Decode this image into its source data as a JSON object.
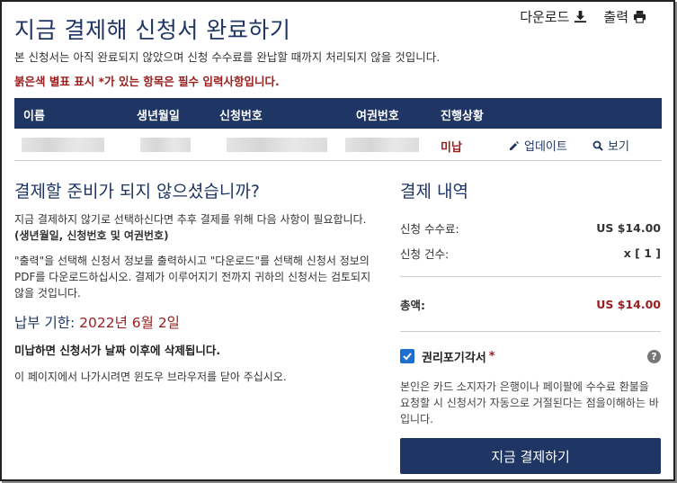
{
  "page": {
    "title": "지금 결제해 신청서 완료하기",
    "notice": "본 신청서는 아직 완료되지 않았으며 신청 수수료를 완납할 때까지 처리되지 않을 것입니다.",
    "required_note": "붉은색 별표 표시 *가 있는 항목은 필수 입력사항입니다."
  },
  "topbar": {
    "download_label": "다운로드",
    "print_label": "출력"
  },
  "table": {
    "headers": [
      "이름",
      "생년월일",
      "신청번호",
      "여권번호",
      "진행상황"
    ],
    "row": {
      "status": "미납",
      "update_label": "업데이트",
      "view_label": "보기"
    }
  },
  "left": {
    "heading": "결제할 준비가 되지 않으셨습니까?",
    "para1": "지금 결제하지 않기로 선택하신다면 추후 결제를 위해 다음 사항이 필요합니다.",
    "para1_bold": "(생년월일, 신청번호 및 여권번호)",
    "para2": "\"출력\"을 선택해 신청서 정보를 출력하시고 \"다운로드\"를 선택해 신청서 정보의 PDF를 다운로드하십시오. 결제가 이루어지기 전까지 귀하의 신청서는 검토되지 않을 것입니다.",
    "deadline_label": "납부 기한:",
    "deadline_date": "2022년 6월 2일",
    "warning": "미납하면 신청서가 날짜 이후에 삭제됩니다.",
    "close_note": "이 페이지에서 나가시려면 윈도우 브라우저를 닫아 주십시오."
  },
  "summary": {
    "heading": "결제 내역",
    "fee_label": "신청 수수료:",
    "fee_value": "US $14.00",
    "count_label": "신청 건수:",
    "count_value": "x [ 1 ]",
    "total_label": "총액:",
    "total_value": "US $14.00",
    "waiver_label": "권리포기각서",
    "waiver_required": "*",
    "help_glyph": "?",
    "waiver_text": "본인은 카드 소지자가 은행이나 페이팔에 수수료 환불을 요청할 시 신청서가 자동으로 거절된다는 점을이해하는 바입니다.",
    "pay_label": "지금 결제하기"
  },
  "colors": {
    "navy": "#1f3564",
    "required": "#9b1c1c",
    "checkbox": "#1f6fd0"
  }
}
